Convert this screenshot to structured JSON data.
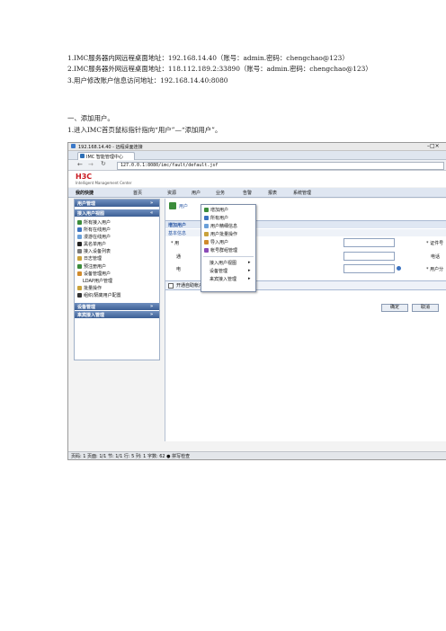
{
  "doc": {
    "line1": "1.IMC服务器内网远程桌面地址：192.168.14.40（账号：admin.密码：chengchao@123）",
    "line2": "2.IMC服务器外网远程桌面地址：118.112.189.2:33890（账号：admin.密码：chengchao@123）",
    "line3": "3.用户修改账户信息访问地址：192.168.14.40:8080",
    "section": "一、添加用户。",
    "step1": "1.进入IMC首页鼠标指针指向“用户”—“添加用户”。"
  },
  "screenshot": {
    "window_title": "192.168.14.40 - 远程桌面连接",
    "tab_title": "IMC 智能管理中心",
    "url": "127.0.0.1:8080/imc/fault/default.jsf",
    "logo": "H3C",
    "logo_sub": "Intelligent Management Center",
    "nav": [
      "我的快捷",
      "首页",
      "资源",
      "用户",
      "业务",
      "告警",
      "报表",
      "系统管理"
    ],
    "sidebar": {
      "header1": "用户管理",
      "header2": "接入用户视图",
      "items": [
        "所有接入用户",
        "所有在线用户",
        "漫游在线用户",
        "黑名单用户",
        "接入设备列表",
        "日志管理",
        "预注册用户",
        "设备管理用户",
        "LDAP用户管理",
        "批量操作",
        "ldap-icon",
        "组织/隔离用户配置"
      ],
      "items_text": [
        "所有接入用户",
        "所有在线用户",
        "漫游在线用户",
        "黑名单用户",
        "接入设备列表",
        "日志管理",
        "预注册用户",
        "设备管理用户",
        "LDAP用户管理",
        "批量操作",
        "组织/隔离用户配置"
      ],
      "header3": "设备管理",
      "header4": "来宾接入管理"
    },
    "content": {
      "breadcrumb": "用户",
      "panel_title": "增加用户",
      "basic_info": "基本信息",
      "labels_left": [
        "* 用",
        "通",
        "电"
      ],
      "labels_right": [
        "* 证件号",
        "电话",
        "* 用户分"
      ],
      "open_account": "开通自助帐户",
      "ok": "确定",
      "cancel": "取消"
    },
    "menu": {
      "items": [
        "增加用户",
        "所有用户",
        "用户精细信息",
        "用户批量操作",
        "导入用户",
        "帐号群组管理",
        "接入用户视图",
        "设备管理",
        "来宾接入管理"
      ]
    },
    "status": "页码: 1   页面: 1/1   节: 1/1   行: 5   列: 1   字数: 62   ● 拼写检查"
  }
}
